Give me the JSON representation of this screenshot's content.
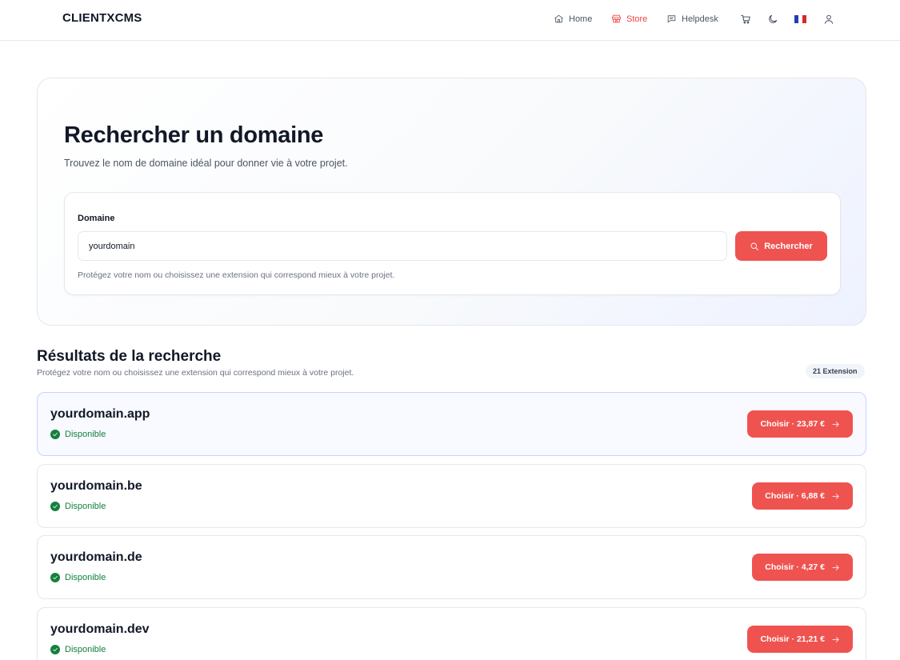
{
  "header": {
    "brand": "CLIENTXCMS",
    "nav": [
      {
        "label": "Home",
        "icon": "home-icon",
        "active": false
      },
      {
        "label": "Store",
        "icon": "store-icon",
        "active": true
      },
      {
        "label": "Helpdesk",
        "icon": "chat-icon",
        "active": false
      }
    ],
    "icons": [
      "cart-icon",
      "moon-icon",
      "flag-fr-icon",
      "user-icon"
    ]
  },
  "hero": {
    "title": "Rechercher un domaine",
    "subtitle": "Trouvez le nom de domaine idéal pour donner vie à votre projet.",
    "field_label": "Domaine",
    "field_value": "yourdomain",
    "button_label": "Rechercher",
    "help": "Protégez votre nom ou choisissez une extension qui correspond mieux à votre projet."
  },
  "results": {
    "title": "Résultats de la recherche",
    "subtitle": "Protégez votre nom ou choisissez une extension qui correspond mieux à votre projet.",
    "count": "21 Extension",
    "items": [
      {
        "domain": "yourdomain.app",
        "status": "Disponible",
        "button": "Choisir · 23,87 €"
      },
      {
        "domain": "yourdomain.be",
        "status": "Disponible",
        "button": "Choisir · 6,88 €"
      },
      {
        "domain": "yourdomain.de",
        "status": "Disponible",
        "button": "Choisir · 4,27 €"
      },
      {
        "domain": "yourdomain.dev",
        "status": "Disponible",
        "button": "Choisir · 21,21 €"
      }
    ]
  },
  "colors": {
    "accent": "#ef5350",
    "success": "#15803d",
    "text": "#111827"
  }
}
